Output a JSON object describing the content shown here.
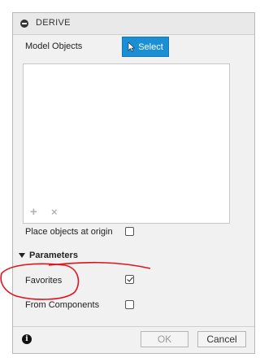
{
  "dialog": {
    "title": "DERIVE",
    "model_objects_label": "Model Objects",
    "select_label": "Select",
    "place_objects_label": "Place objects at origin",
    "place_objects_checked": false,
    "parameters_header": "Parameters",
    "favorites_label": "Favorites",
    "favorites_checked": true,
    "from_components_label": "From Components",
    "from_components_checked": false,
    "ok_label": "OK",
    "cancel_label": "Cancel"
  },
  "colors": {
    "accent": "#1b8fd6",
    "annotation": "#e0141e"
  },
  "icons": [
    "collapse-icon",
    "cursor-icon",
    "plus-icon",
    "close-icon",
    "triangle-down-icon",
    "info-icon"
  ]
}
